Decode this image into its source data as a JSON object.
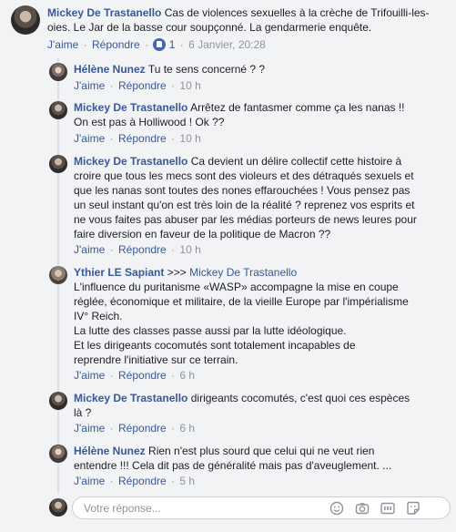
{
  "comment": {
    "author": "Mickey De Trastanello",
    "text": "Cas de violences sexuelles à la crèche de Trifouilli-les-oies. Le Jar de la basse cour soupçonné. La gendarmerie enquête.",
    "like": "J'aime",
    "reply": "Répondre",
    "like_count": "1",
    "time": "6 Janvier, 20:28"
  },
  "replies": [
    {
      "author": "Hélène Nunez",
      "text": "Tu te sens concerné ? ?",
      "like": "J'aime",
      "reply": "Répondre",
      "time": "10 h"
    },
    {
      "author": "Mickey De Trastanello",
      "text": "Arrêtez de fantasmer comme ça les nanas !! On est pas à Holliwood ! Ok ??",
      "like": "J'aime",
      "reply": "Répondre",
      "time": "10 h"
    },
    {
      "author": "Mickey De Trastanello",
      "text": "Ca devient un délire collectif cette histoire à croire que tous les mecs sont des violeurs et des détraqués sexuels et que les nanas sont toutes des nones effarouchées ! Vous pensez pas un seul instant qu'on est très loin de la réalité ? reprenez vos esprits et ne vous faites pas abuser par les médias porteurs de news leures pour faire diversion en faveur de la politique de Macron ??",
      "like": "J'aime",
      "reply": "Répondre",
      "time": "10 h"
    },
    {
      "author": "Ythier LE Sapiant",
      "arrow": ">>>",
      "target": "Mickey De Trastanello",
      "paragraphs": [
        "L'influence du puritanisme «WASP» accompagne la mise en coupe réglée, économique et militaire, de la vieille Europe par l'impérialisme IV° Reich.",
        "La lutte des classes passe aussi par la lutte idéologique.",
        "Et les dirigeants cocomutés sont totalement incapables de reprendre l'initiative sur ce terrain."
      ],
      "like": "J'aime",
      "reply": "Répondre",
      "time": "6 h"
    },
    {
      "author": "Mickey De Trastanello",
      "text": "dirigeants cocomutés, c'est quoi ces espèces là ?",
      "like": "J'aime",
      "reply": "Répondre",
      "time": "6 h"
    },
    {
      "author": "Hélène Nunez",
      "text": "Rien n'est plus sourd que celui qui ne veut rien entendre !!! Cela dit pas de généralité mais pas d'aveuglement. ...",
      "like": "J'aime",
      "reply": "Répondre",
      "time": "5 h"
    }
  ],
  "reply_box": {
    "placeholder": "Votre réponse..."
  },
  "toolbar_icons": [
    "emoji-icon",
    "camera-icon",
    "gif-icon",
    "sticker-icon"
  ],
  "colors": {
    "link": "#385898",
    "background": "#f2f3f5",
    "meta": "#90949c"
  }
}
